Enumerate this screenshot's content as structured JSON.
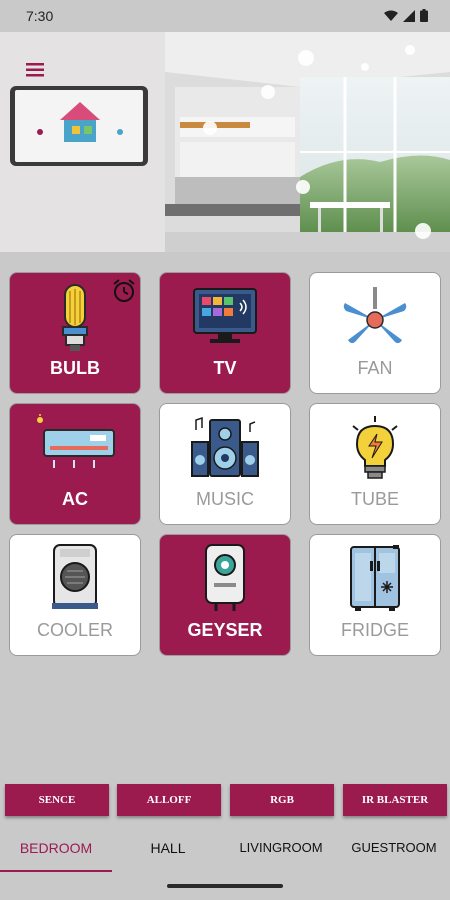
{
  "status_bar": {
    "time": "7:30"
  },
  "hero": {
    "menu_icon": "hamburger-menu-icon"
  },
  "devices": [
    {
      "label": "BULB",
      "state": "on",
      "icon": "bulb-icon",
      "has_timer": true
    },
    {
      "label": "TV",
      "state": "on",
      "icon": "tv-icon",
      "has_timer": false
    },
    {
      "label": "FAN",
      "state": "off",
      "icon": "fan-icon",
      "has_timer": false
    },
    {
      "label": "AC",
      "state": "on",
      "icon": "ac-icon",
      "has_timer": false
    },
    {
      "label": "MUSIC",
      "state": "off",
      "icon": "speaker-icon",
      "has_timer": false
    },
    {
      "label": "TUBE",
      "state": "off",
      "icon": "lightbulb-icon",
      "has_timer": false
    },
    {
      "label": "COOLER",
      "state": "off",
      "icon": "cooler-icon",
      "has_timer": false
    },
    {
      "label": "GEYSER",
      "state": "on",
      "icon": "geyser-icon",
      "has_timer": false
    },
    {
      "label": "FRIDGE",
      "state": "off",
      "icon": "fridge-icon",
      "has_timer": false
    }
  ],
  "actions": [
    "SENCE",
    "ALLOFF",
    "RGB",
    "IR BLASTER"
  ],
  "tabs": [
    {
      "label": "BEDROOM",
      "active": true
    },
    {
      "label": "HALL",
      "active": false
    },
    {
      "label": "LIVINGROOM",
      "active": false
    },
    {
      "label": "GUESTROOM",
      "active": false
    }
  ],
  "colors": {
    "accent": "#9b1b4f",
    "background": "#c9c9c9",
    "tile_off": "#ffffff"
  }
}
